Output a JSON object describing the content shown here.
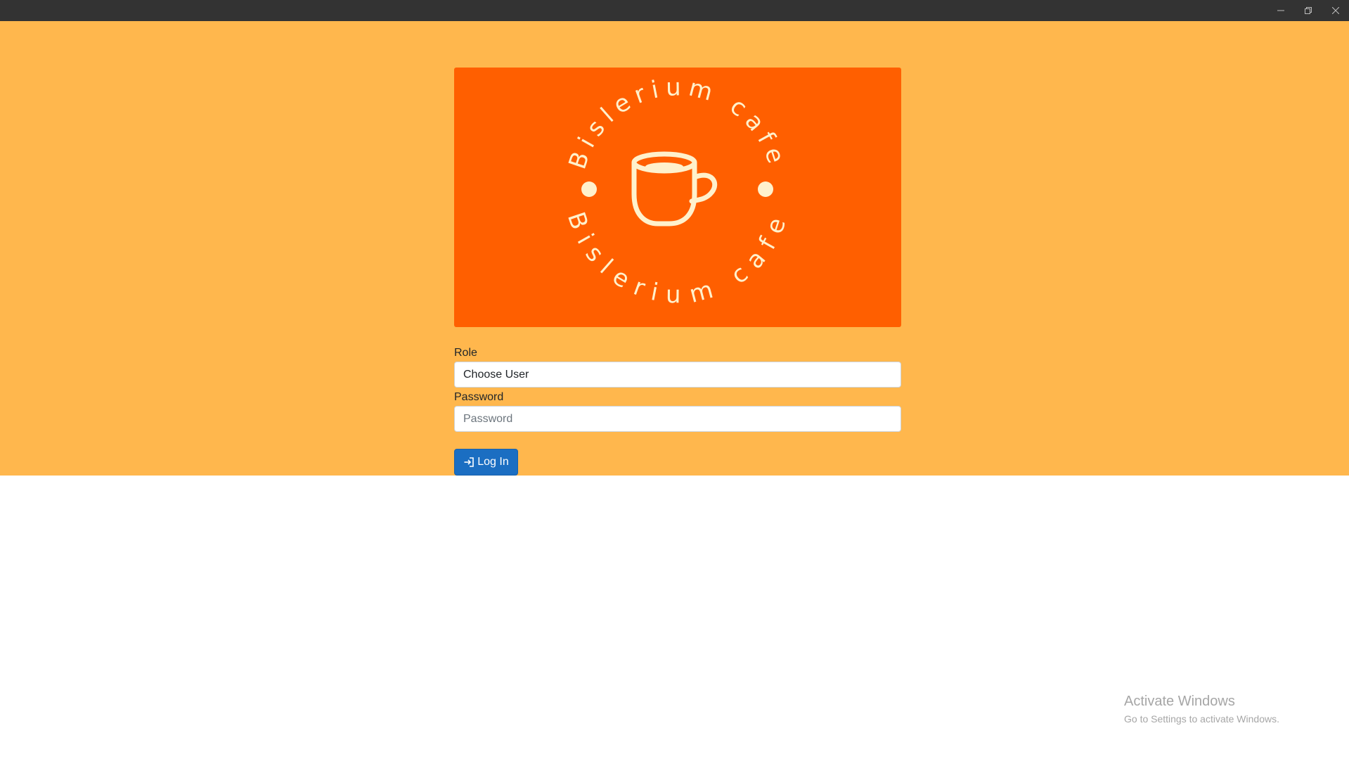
{
  "window": {
    "controls": {
      "minimize_icon": "minimize-icon",
      "restore_icon": "restore-icon",
      "close_icon": "close-icon"
    }
  },
  "banner": {
    "logo_text": "Bislerium cafe",
    "colors": {
      "background": "#ff5f00",
      "foreground": "#fff1cc"
    }
  },
  "form": {
    "role": {
      "label": "Role",
      "selected_value": "Choose User"
    },
    "password": {
      "label": "Password",
      "placeholder": "Password",
      "value": ""
    },
    "submit": {
      "label": "Log In",
      "icon": "login-icon"
    }
  },
  "theme": {
    "page_background": "#ffb74d",
    "titlebar": "#333333",
    "button": "#1b6ec2"
  },
  "watermark": {
    "title": "Activate Windows",
    "subtitle": "Go to Settings to activate Windows."
  }
}
